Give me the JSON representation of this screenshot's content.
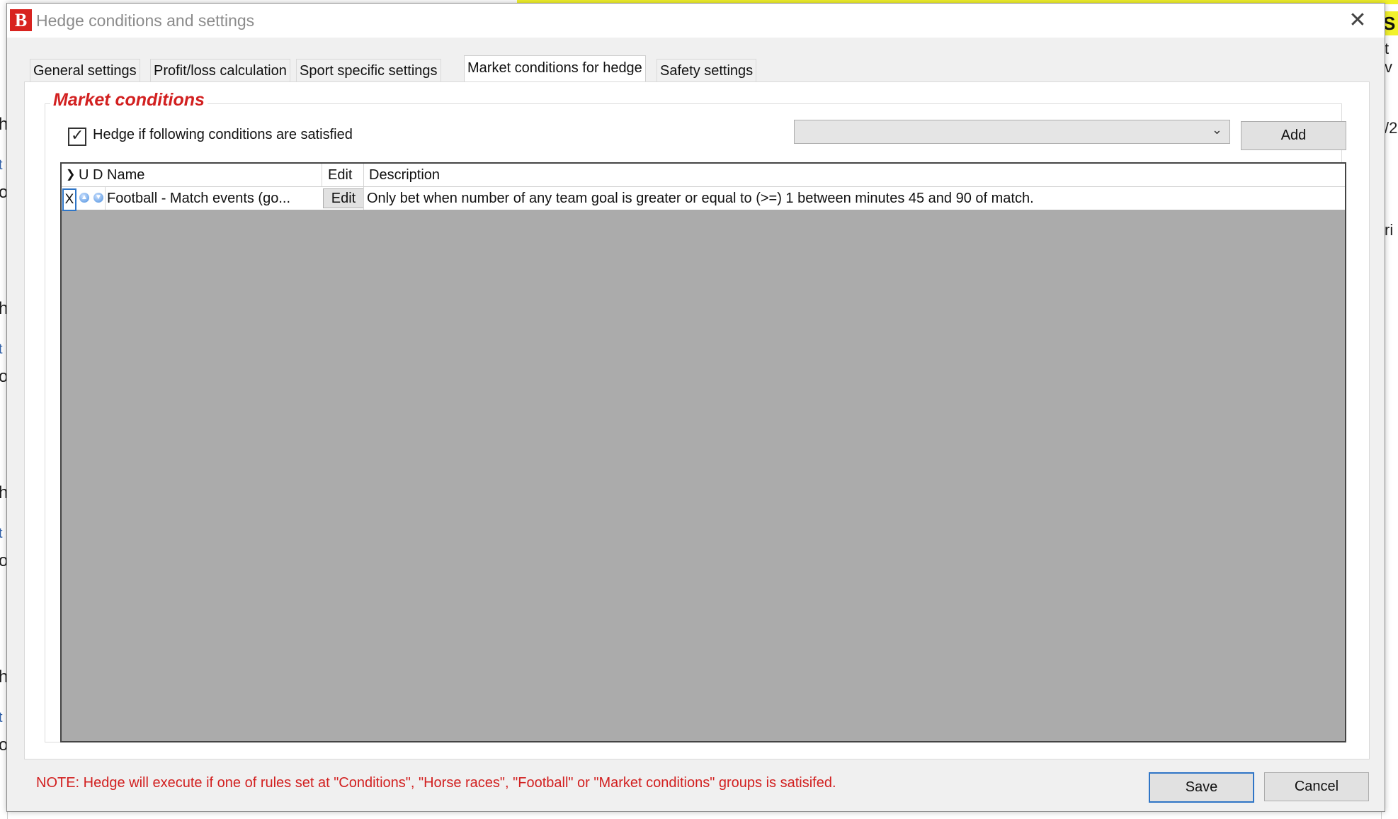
{
  "window": {
    "title": "Hedge conditions and settings",
    "logo_text": "B",
    "close_glyph": "✕"
  },
  "tabs": [
    {
      "label": "General settings",
      "active": false
    },
    {
      "label": "Profit/loss calculation",
      "active": false
    },
    {
      "label": "Sport specific settings",
      "active": false
    },
    {
      "label": "Market conditions for hedge",
      "active": true
    },
    {
      "label": "Safety settings",
      "active": false
    }
  ],
  "market_conditions": {
    "group_title": "Market conditions",
    "hedge_checkbox": {
      "label": "Hedge if following conditions are satisfied",
      "checked": true
    },
    "dropdown": {
      "value": ""
    },
    "add_label": "Add"
  },
  "grid": {
    "columns": [
      {
        "key": "expand",
        "label": "❯"
      },
      {
        "key": "u",
        "label": "U"
      },
      {
        "key": "d",
        "label": "D"
      },
      {
        "key": "name",
        "label": "Name"
      },
      {
        "key": "edit",
        "label": "Edit"
      },
      {
        "key": "description",
        "label": "Description"
      }
    ],
    "rows": [
      {
        "delete": "X",
        "name": "Football - Match events (go...",
        "edit": "Edit",
        "description": "Only bet when number of any team goal is greater or equal to (>=) 1 between minutes 45 and 90 of match."
      }
    ]
  },
  "footer": {
    "note": "NOTE: Hedge will execute if one of rules set at \"Conditions\", \"Horse races\", \"Football\" or \"Market conditions\" groups is satisifed.",
    "save_label": "Save",
    "cancel_label": "Cancel"
  },
  "colors": {
    "accent_red": "#d22020",
    "focus_blue": "#2f75c6",
    "grid_empty": "#ababab",
    "dialog_bg": "#f0f0f0"
  },
  "background_app": {
    "right_top_text": "S",
    "right_fragments": [
      "t v",
      "/2",
      "ri"
    ],
    "left_fragments": [
      "h",
      "t",
      "ov"
    ]
  }
}
